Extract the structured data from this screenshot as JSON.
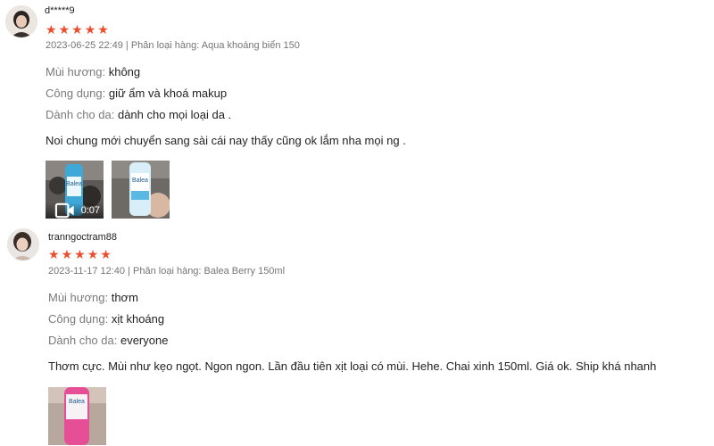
{
  "reviews": [
    {
      "username": "d*****9",
      "rating": 5,
      "date": "2023-06-25 22:49",
      "separator": "|",
      "variation_label": "Phân loại hàng:",
      "variation_value": "Aqua khoáng biển 150",
      "attributes": [
        {
          "key": "Mùi hương:",
          "value": "không"
        },
        {
          "key": "Công dụng:",
          "value": "giữ ẩm và khoá makup"
        },
        {
          "key": "Dành cho da:",
          "value": "dành cho mọi loại da ."
        }
      ],
      "comment": "Noi chung mới chuyển sang sài cái nay thấy cũng ok lắm nha mọi ng .",
      "media": [
        {
          "type": "video",
          "duration": "0:07",
          "icon": "video-camera-icon",
          "product_text": "Balea"
        },
        {
          "type": "image",
          "product_text": "Balea"
        }
      ]
    },
    {
      "username": "tranngoctram88",
      "rating": 5,
      "date": "2023-11-17 12:40",
      "separator": "|",
      "variation_label": "Phân loại hàng:",
      "variation_value": "Balea Berry 150ml",
      "attributes": [
        {
          "key": "Mùi hương:",
          "value": "thơm"
        },
        {
          "key": "Công dụng:",
          "value": "xịt khoáng"
        },
        {
          "key": "Dành cho da:",
          "value": "everyone"
        }
      ],
      "comment": "Thơm cực. Mùi như kẹo ngọt. Ngon ngon. Lần đầu tiên xịt loại có mùi. Hehe. Chai xinh 150ml. Giá ok. Ship khá nhanh",
      "media": [
        {
          "type": "image",
          "product_text": "Balea"
        }
      ]
    }
  ],
  "colors": {
    "star": "#ee4d2d",
    "meta": "#757575",
    "attr_key": "#7a7a7a"
  }
}
